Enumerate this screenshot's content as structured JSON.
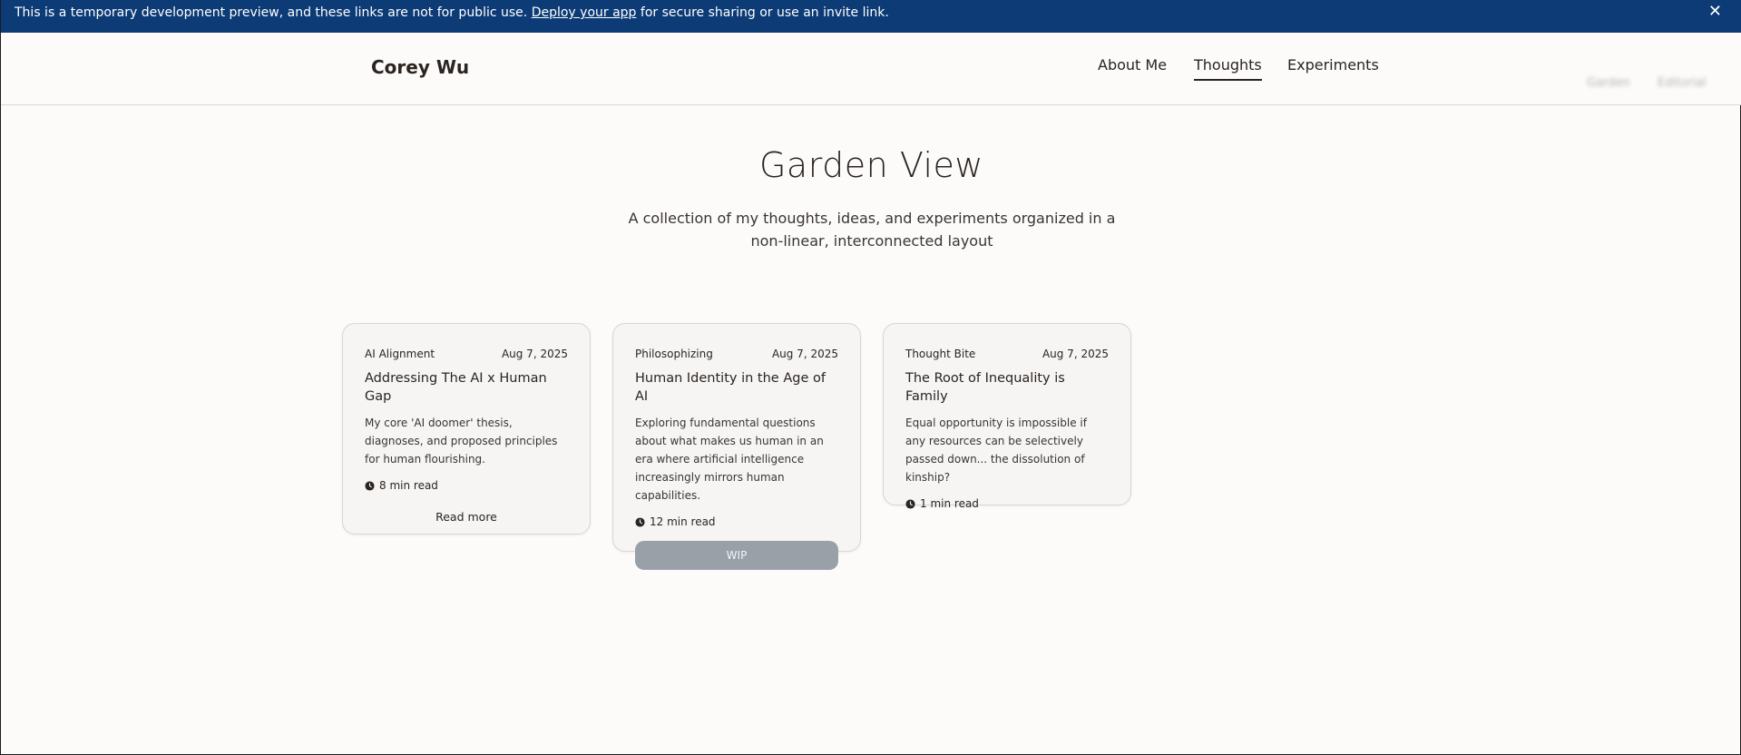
{
  "banner": {
    "text_before": "This is a temporary development preview, and these links are not for public use. ",
    "link_text": "Deploy your app",
    "text_after": " for secure sharing or use an invite link.",
    "close_glyph": "✕",
    "background": "#0c3b76"
  },
  "header": {
    "brand": "Corey Wu",
    "nav": {
      "about": "About Me",
      "thoughts": "Thoughts",
      "experiments": "Experiments"
    },
    "view_toggle": {
      "garden": "Garden",
      "editorial": "Editorial"
    }
  },
  "hero": {
    "title": "Garden View",
    "subtitle": "A collection of my thoughts, ideas, and experiments organized in a non-linear, interconnected layout"
  },
  "cards": [
    {
      "category": "AI Alignment",
      "date": "Aug 7, 2025",
      "title": "Addressing The AI x Human Gap",
      "description": "My core 'AI doomer' thesis, diagnoses, and proposed principles for human flourishing.",
      "read_time": "8 min read",
      "action": "Read more"
    },
    {
      "category": "Philosophizing",
      "date": "Aug 7, 2025",
      "title": "Human Identity in the Age of AI",
      "description": "Exploring fundamental questions about what makes us human in an era where artificial intelligence increasingly mirrors human capabilities.",
      "read_time": "12 min read",
      "action": "WIP"
    },
    {
      "category": "Thought Bite",
      "date": "Aug 7, 2025",
      "title": "The Root of Inequality is Family",
      "description": "Equal opportunity is impossible if any resources can be selectively passed down... the dissolution of kinship?",
      "read_time": "1 min read"
    }
  ],
  "icons": {
    "clock": "clock-icon",
    "close": "close-icon"
  }
}
